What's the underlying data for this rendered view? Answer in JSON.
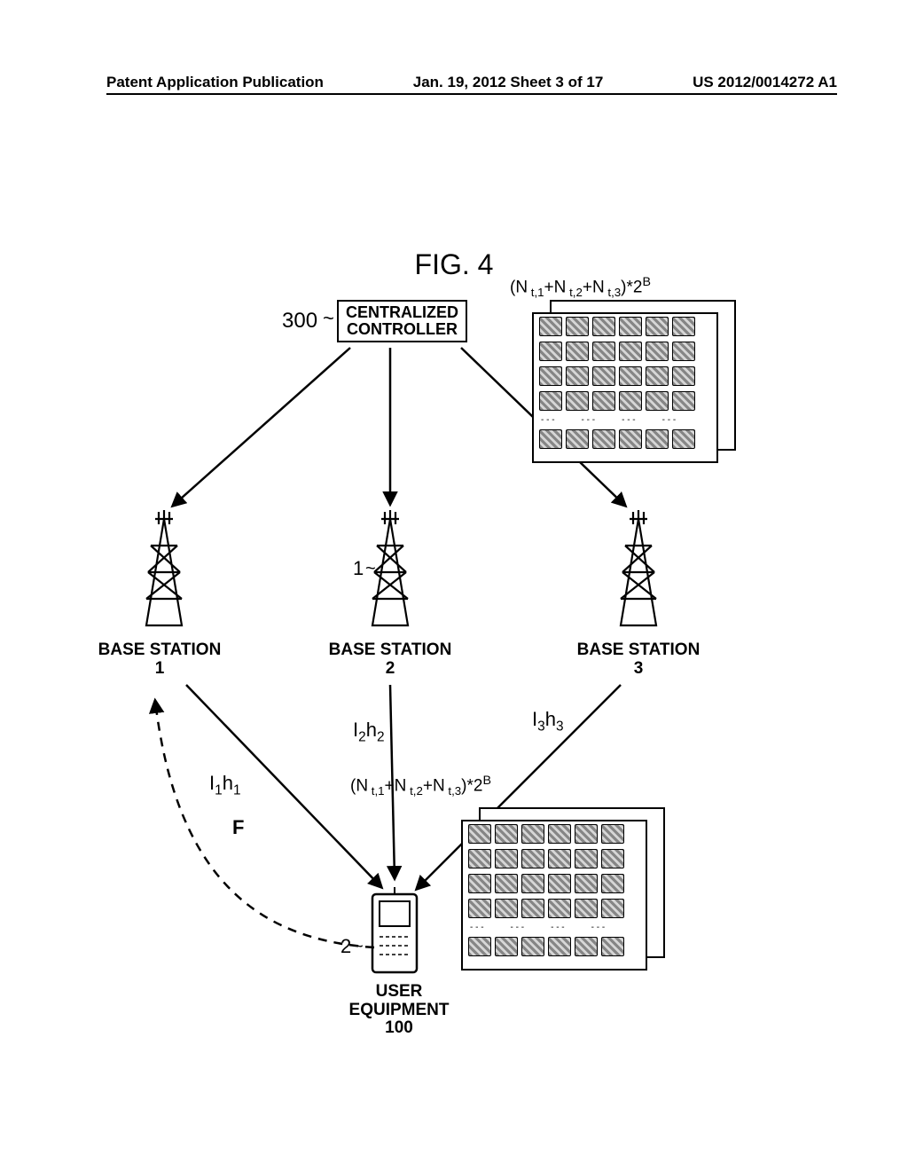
{
  "header": {
    "left": "Patent Application Publication",
    "mid": "Jan. 19, 2012  Sheet 3 of 17",
    "right": "US 2012/0014272 A1"
  },
  "figure": {
    "title": "FIG. 4",
    "controller": {
      "label_l1": "CENTRALIZED",
      "label_l2": "CONTROLLER",
      "ref": "300"
    },
    "codebook_dim": "(N t,1 + N t,2 + N t,3 ) * 2 B",
    "base_stations": [
      {
        "label": "BASE STATION",
        "num": "1"
      },
      {
        "label": "BASE STATION",
        "num": "2"
      },
      {
        "label": "BASE STATION",
        "num": "3"
      }
    ],
    "bs2_ref": "1",
    "channels": {
      "c1": "I1h1",
      "c2": "I2h2",
      "c3": "I3h3"
    },
    "feedback": "F",
    "ue": {
      "label_l1": "USER",
      "label_l2": "EQUIPMENT",
      "num": "100",
      "ref": "2"
    }
  }
}
